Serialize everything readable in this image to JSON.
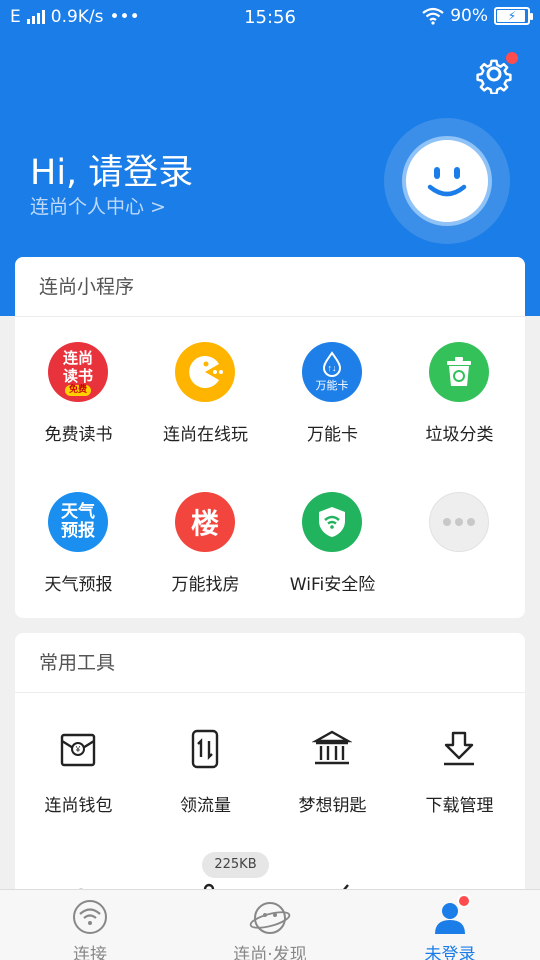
{
  "status_bar": {
    "network": "E",
    "speed": "0.9K/s",
    "more": "•••",
    "time": "15:56",
    "battery": "90%"
  },
  "header": {
    "greeting": "Hi, 请登录",
    "profile_link": "连尚个人中心 >"
  },
  "mini_programs": {
    "title": "连尚小程序",
    "items": [
      {
        "label": "免费读书",
        "icon": "book-icon",
        "color": "#e8323c",
        "icon_text": "连尚读书",
        "icon_sub": "免费"
      },
      {
        "label": "连尚在线玩",
        "icon": "game-icon",
        "color": "#ffb400",
        "icon_text": ""
      },
      {
        "label": "万能卡",
        "icon": "data-card-icon",
        "color": "#1f7fe8",
        "icon_text": "万能卡"
      },
      {
        "label": "垃圾分类",
        "icon": "trash-icon",
        "color": "#35c15a",
        "icon_text": ""
      },
      {
        "label": "天气预报",
        "icon": "weather-icon",
        "color": "#1a8ff0",
        "icon_text": "天气预报"
      },
      {
        "label": "万能找房",
        "icon": "house-icon",
        "color": "#f2453d",
        "icon_text": "楼"
      },
      {
        "label": "WiFi安全险",
        "icon": "wifi-shield-icon",
        "color": "#22b35f",
        "icon_text": ""
      },
      {
        "label": "",
        "icon": "more-icon",
        "color": "#eeeeee",
        "icon_text": ""
      }
    ]
  },
  "tools": {
    "title": "常用工具",
    "items": [
      {
        "label": "连尚钱包",
        "icon": "wallet-icon"
      },
      {
        "label": "领流量",
        "icon": "traffic-icon"
      },
      {
        "label": "梦想钥匙",
        "icon": "bank-icon"
      },
      {
        "label": "下载管理",
        "icon": "download-icon"
      }
    ],
    "download_size": "225KB"
  },
  "tab_bar": {
    "tabs": [
      {
        "label": "连接",
        "icon": "wifi-icon"
      },
      {
        "label": "连尚·发现",
        "icon": "planet-face-icon"
      },
      {
        "label": "未登录",
        "icon": "user-icon",
        "active": true
      }
    ]
  },
  "colors": {
    "primary": "#1b7de8",
    "badge": "#ff4d4f"
  }
}
